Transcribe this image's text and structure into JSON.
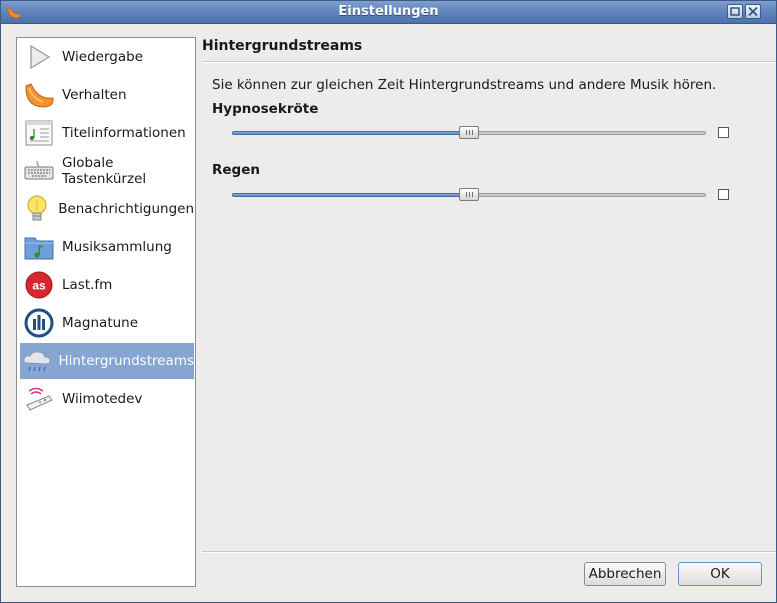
{
  "window": {
    "title": "Einstellungen"
  },
  "sidebar": {
    "items": [
      {
        "label": "Wiedergabe",
        "icon": "play-icon"
      },
      {
        "label": "Verhalten",
        "icon": "clementine-icon"
      },
      {
        "label": "Titelinformationen",
        "icon": "document-music-icon"
      },
      {
        "label": "Globale\nTastenkürzel",
        "icon": "keyboard-icon"
      },
      {
        "label": "Benachrichtigungen",
        "icon": "lightbulb-icon"
      },
      {
        "label": "Musiksammlung",
        "icon": "music-folder-icon"
      },
      {
        "label": "Last.fm",
        "icon": "lastfm-icon"
      },
      {
        "label": "Magnatune",
        "icon": "magnatune-icon"
      },
      {
        "label": "Hintergrundstreams",
        "icon": "rain-cloud-icon",
        "selected": true
      },
      {
        "label": "Wiimotedev",
        "icon": "wiimote-icon"
      }
    ]
  },
  "main": {
    "title": "Hintergrundstreams",
    "description": "Sie können zur gleichen Zeit Hintergrundstreams und andere Musik hören.",
    "streams": [
      {
        "label": "Hypnosekröte",
        "volume": 0.5,
        "enabled": false
      },
      {
        "label": "Regen",
        "volume": 0.5,
        "enabled": false
      }
    ]
  },
  "buttons": {
    "cancel": "Abbrechen",
    "ok": "OK"
  },
  "colors": {
    "titlebar": "#5f82b9",
    "selection": "#86a5d2",
    "slider_fill": "#5a82bd"
  }
}
